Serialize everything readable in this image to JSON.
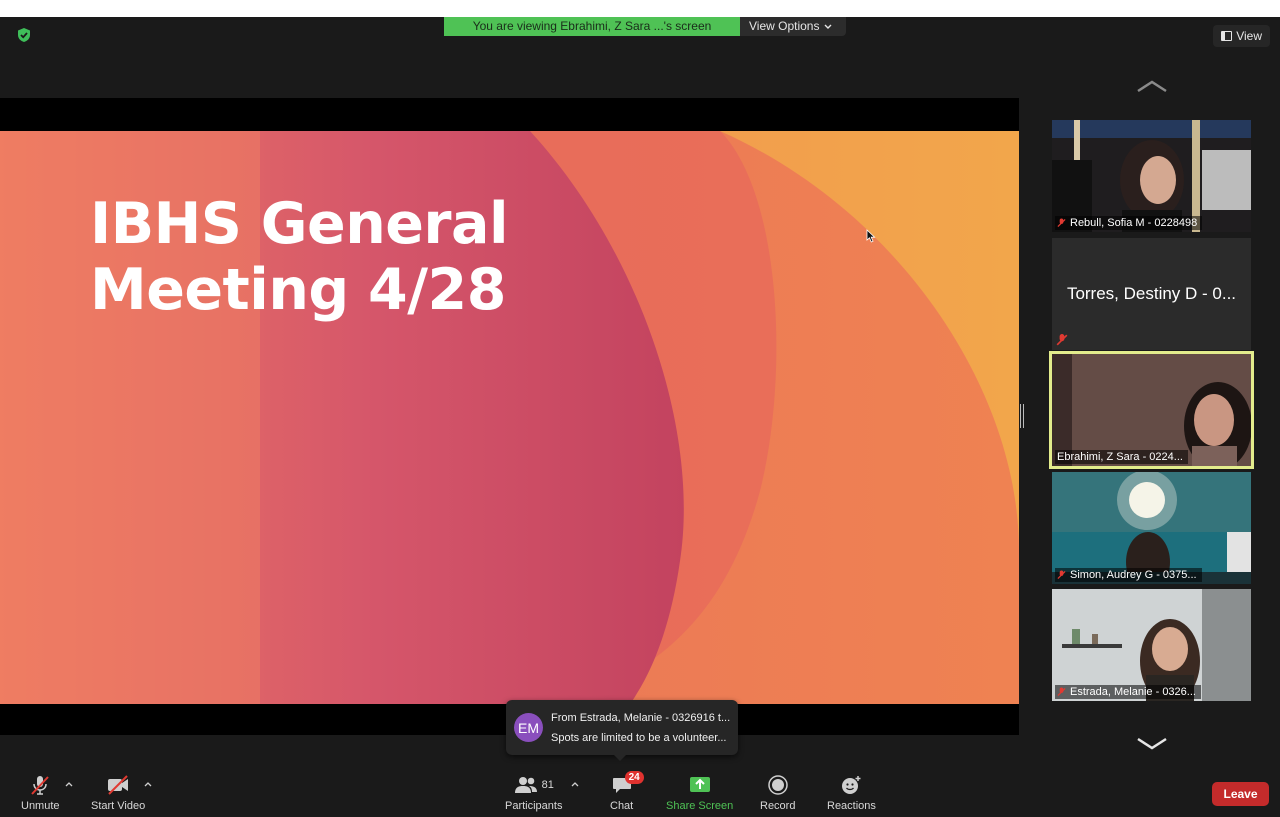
{
  "share_banner": {
    "message": "You are viewing Ebrahimi, Z Sara ...'s screen",
    "options_label": "View Options"
  },
  "view_button": {
    "label": "View"
  },
  "slide": {
    "title_line1": "IBHS General",
    "title_line2": "Meeting 4/28"
  },
  "participants_tiles": [
    {
      "name": "Rebull, Sofia M - 0228498",
      "muted": true,
      "video": true
    },
    {
      "name": "Torres, Destiny D - 0...",
      "muted": true,
      "video": false
    },
    {
      "name": "Ebrahimi, Z Sara - 0224...",
      "muted": false,
      "video": true,
      "active_speaker": true
    },
    {
      "name": "Simon, Audrey G - 0375...",
      "muted": true,
      "video": true
    },
    {
      "name": "Estrada, Melanie - 0326...",
      "muted": true,
      "video": true
    }
  ],
  "chat_notification": {
    "initials": "EM",
    "from_line": "From Estrada, Melanie - 0326916 t...",
    "message_preview": "Spots are limited to be a volunteer..."
  },
  "toolbar": {
    "unmute_label": "Unmute",
    "start_video_label": "Start Video",
    "participants_label": "Participants",
    "participants_count": "81",
    "chat_label": "Chat",
    "chat_badge": "24",
    "share_screen_label": "Share Screen",
    "record_label": "Record",
    "reactions_label": "Reactions",
    "leave_label": "Leave"
  },
  "colors": {
    "share_green": "#4fc255",
    "leave_red": "#c42b2b",
    "active_speaker_outline": "#e3ec8c",
    "avatar_purple": "#8a4fbd"
  }
}
